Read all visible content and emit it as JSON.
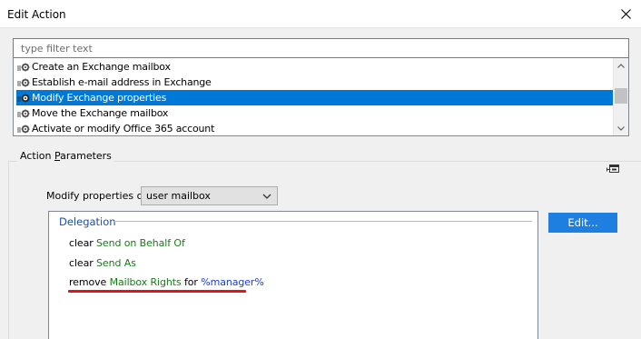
{
  "window": {
    "title": "Edit Action"
  },
  "filter": {
    "placeholder": "type filter text",
    "value": ""
  },
  "actions": [
    {
      "label": "Create an Exchange mailbox",
      "selected": false
    },
    {
      "label": "Establish e-mail address in Exchange",
      "selected": false
    },
    {
      "label": "Modify Exchange properties",
      "selected": true
    },
    {
      "label": "Move the Exchange mailbox",
      "selected": false
    },
    {
      "label": "Activate or modify Office 365 account",
      "selected": false
    }
  ],
  "parameters": {
    "group_title_prefix": "Action ",
    "group_title_accel": "P",
    "group_title_rest": "arameters",
    "modify_label": "Modify properties of",
    "modify_value": "user mailbox",
    "section_title": "Delegation",
    "edit_label": "Edit...",
    "rules": [
      {
        "verb": "clear",
        "target": "Send on Behalf Of"
      },
      {
        "verb": "clear",
        "target": "Send As"
      },
      {
        "verb": "remove",
        "target": "Mailbox Rights",
        "prep": "for",
        "value": "%manager%"
      }
    ]
  },
  "colors": {
    "selection": "#0078d7",
    "accent_button": "#1e7fe0",
    "highlight_underline": "#e0141e"
  }
}
